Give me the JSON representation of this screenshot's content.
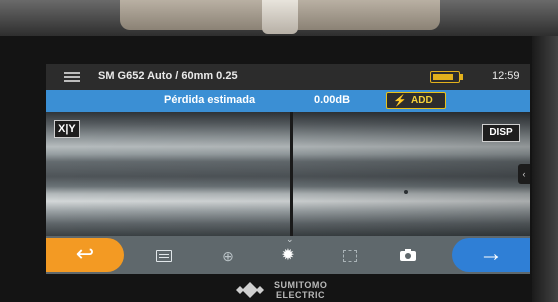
{
  "titlebar": {
    "profile": "SM G652 Auto / 60mm 0.25",
    "battery_icon": "battery-icon",
    "battery_level": 0.85,
    "time": "12:59"
  },
  "status": {
    "loss_label": "Pérdida estimada",
    "loss_value": "0.00dB",
    "add_label": "ADD",
    "add_icon": "lightning-icon"
  },
  "viewer": {
    "xy_label": "X|Y",
    "disp_label": "DISP",
    "side_tab_icon": "chevron-left-icon",
    "side_tab_glyph": "‹"
  },
  "toolbar": {
    "back_icon": "back-arrow-icon",
    "back_glyph": "↩",
    "next_icon": "right-arrow-icon",
    "next_glyph": "→",
    "icons": [
      "list-icon",
      "zoom-icon",
      "brightness-icon",
      "focus-icon",
      "camera-icon"
    ]
  },
  "brand": {
    "line1": "SUMITOMO",
    "line2": "ELECTRIC"
  },
  "colors": {
    "status_bar": "#3b8fd4",
    "back_button": "#f39a23",
    "next_button": "#2f7fd6",
    "add_button_border": "#e8c21a",
    "battery": "#e3b11c"
  }
}
